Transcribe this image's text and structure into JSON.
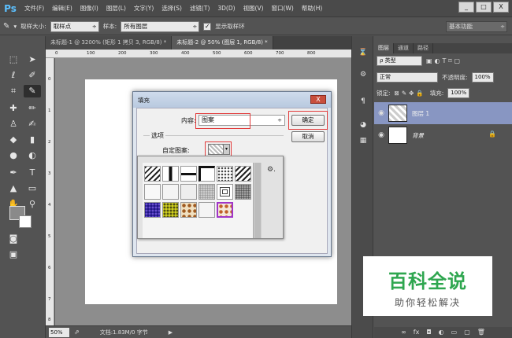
{
  "app": {
    "logo": "Ps"
  },
  "menu": [
    "文件(F)",
    "编辑(E)",
    "图像(I)",
    "图层(L)",
    "文字(Y)",
    "选择(S)",
    "滤镜(T)",
    "3D(D)",
    "视图(V)",
    "窗口(W)",
    "帮助(H)"
  ],
  "window_controls": {
    "minimize": "_",
    "maximize": "□",
    "close": "X"
  },
  "options_bar": {
    "sample_size_label": "取样大小:",
    "sample_size_value": "取样点",
    "sample_label": "样本:",
    "sample_value": "所有图层",
    "show_ring_checked": "✓",
    "show_ring_label": "显示取样环",
    "workspace": "基本功能"
  },
  "doc_tabs": [
    {
      "label": "未标题-1 @ 3200% (矩形 1 拷贝 3, RGB/8) *"
    },
    {
      "label": "未标题-2 @ 50% (图层 1, RGB/8) *"
    }
  ],
  "ruler_top": [
    "0",
    "100",
    "200",
    "300",
    "400",
    "500",
    "600",
    "700",
    "800"
  ],
  "ruler_left": [
    "0",
    "1",
    "2",
    "3",
    "4",
    "5",
    "6",
    "7",
    "8"
  ],
  "status": {
    "zoom": "50%",
    "doc": "文档:1.83M/0 字节"
  },
  "layers_panel": {
    "tabs": [
      "图层",
      "通道",
      "路径"
    ],
    "filter_kind": "ρ 类型",
    "blend_mode": "正常",
    "opacity_label": "不透明度:",
    "opacity_value": "100%",
    "lock_label": "锁定:",
    "fill_label": "填充:",
    "fill_value": "100%",
    "layers": [
      {
        "name": "图层 1",
        "selected": true
      },
      {
        "name": "背景",
        "selected": false
      }
    ]
  },
  "fill_dialog": {
    "title": "填充",
    "close": "X",
    "content_label": "内容:",
    "content_value": "图案",
    "options_label": "选项",
    "custom_pattern_label": "自定图案:",
    "ok": "确定",
    "cancel": "取消"
  },
  "pattern_picker": {
    "gear": "⚙."
  },
  "watermark": {
    "main": "百科全说",
    "sub": "助你轻松解决"
  },
  "colors": {
    "selection": "#8896c2",
    "highlight": "#e23a3a",
    "watermark": "#2ea64f"
  }
}
